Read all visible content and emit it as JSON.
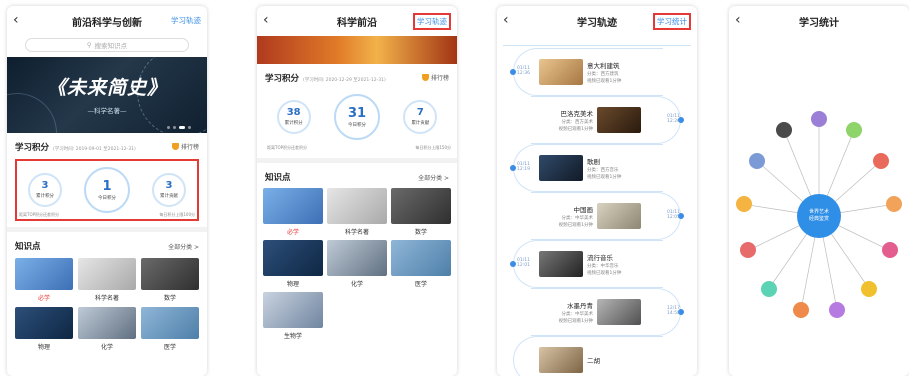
{
  "screen1": {
    "title": "前沿科学与创新",
    "nav_link": "学习轨迹",
    "search_placeholder": "搜索知识点",
    "banner_title": "《未来简史》",
    "banner_sub": "—科学名著—",
    "points": {
      "title": "学习积分",
      "date": "(学习时间: 2019-09-01 至2021-12-31)",
      "rank": "排行榜",
      "total": "3",
      "total_label": "累计积分",
      "today": "1",
      "today_label": "今日积分",
      "contrib": "3",
      "contrib_label": "累计贡献",
      "note_left": "距离TOP积分还差积分",
      "note_right": "每日积分上限100分"
    },
    "kp_title": "知识点",
    "kp_all": "全部分类 >",
    "tiles": [
      "必学",
      "科学名著",
      "数学",
      "物理",
      "化学",
      "医学"
    ]
  },
  "screen2": {
    "title": "科学前沿",
    "nav_link": "学习轨迹",
    "points": {
      "title": "学习积分",
      "date": "(学习时间: 2020-12-29 至2021-12-31)",
      "rank": "排行榜",
      "total": "38",
      "total_label": "累计积分",
      "today": "31",
      "today_label": "今日积分",
      "contrib": "7",
      "contrib_label": "累计贡献",
      "note_left": "距离TOP积分还差积分",
      "note_right": "每日积分上限150分"
    },
    "kp_title": "知识点",
    "kp_all": "全部分类 >",
    "tiles": [
      "必学",
      "科学名著",
      "数学",
      "物理",
      "化学",
      "医学",
      "生物学"
    ]
  },
  "screen3": {
    "title": "学习轨迹",
    "nav_link": "学习统计",
    "items": [
      {
        "date": "01/11 12:36",
        "title": "意大利建筑",
        "cat": "分类：西方建筑",
        "time": "视频已观看1分钟"
      },
      {
        "date": "01/11 12:26",
        "title": "巴洛克美术",
        "cat": "分类：西方美术",
        "time": "视频已观看1分钟"
      },
      {
        "date": "01/11 12:19",
        "title": "歌剧",
        "cat": "分类：西方音乐",
        "time": "视频已观看1分钟"
      },
      {
        "date": "01/11 12:05",
        "title": "中国画",
        "cat": "分类：中华美术",
        "time": "视频已观看1分钟"
      },
      {
        "date": "01/11 12:01",
        "title": "流行音乐",
        "cat": "分类：中华音乐",
        "time": "视频已观看1分钟"
      },
      {
        "date": "12/17 14:58",
        "title": "水墨丹青",
        "cat": "分类：中华美术",
        "time": "视频已观看1分钟"
      },
      {
        "date": "",
        "title": "二胡",
        "cat": "",
        "time": ""
      }
    ]
  },
  "screen4": {
    "title": "学习统计",
    "hub": "世界艺术\n经典鉴赏",
    "node_colors": [
      "#9b7fd6",
      "#8fd46b",
      "#e96a5a",
      "#f2a35a",
      "#e35d8f",
      "#f0c02e",
      "#b57be0",
      "#f08a4a",
      "#5dd3b6",
      "#e86b6b",
      "#f5b342",
      "#7b9ad6",
      "#4a4a4a"
    ]
  }
}
